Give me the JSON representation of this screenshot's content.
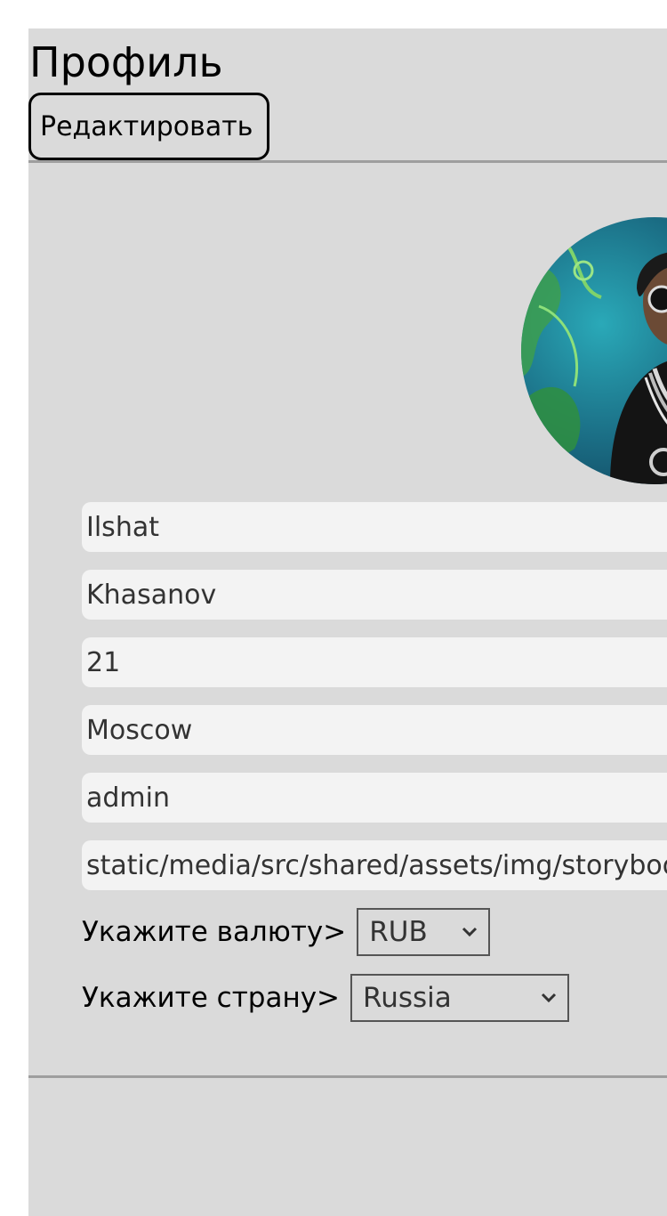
{
  "header": {
    "title": "Профиль",
    "edit_label": "Редактировать"
  },
  "profile": {
    "avatar_icon": "profile-photo",
    "fields": [
      {
        "name": "first-name",
        "value": "Ilshat"
      },
      {
        "name": "last-name",
        "value": "Khasanov"
      },
      {
        "name": "age",
        "value": "21"
      },
      {
        "name": "city",
        "value": "Moscow"
      },
      {
        "name": "role",
        "value": "admin"
      },
      {
        "name": "avatar-path",
        "value": "static/media/src/shared/assets/img/storybook/avatar.jpg"
      }
    ],
    "currency": {
      "label": "Укажите валюту>",
      "selected": "RUB"
    },
    "country": {
      "label": "Укажите страну>",
      "selected": "Russia"
    }
  },
  "colors": {
    "background": "#dadada",
    "field_bg": "#f3f3f3",
    "divider": "#9e9e9e"
  }
}
